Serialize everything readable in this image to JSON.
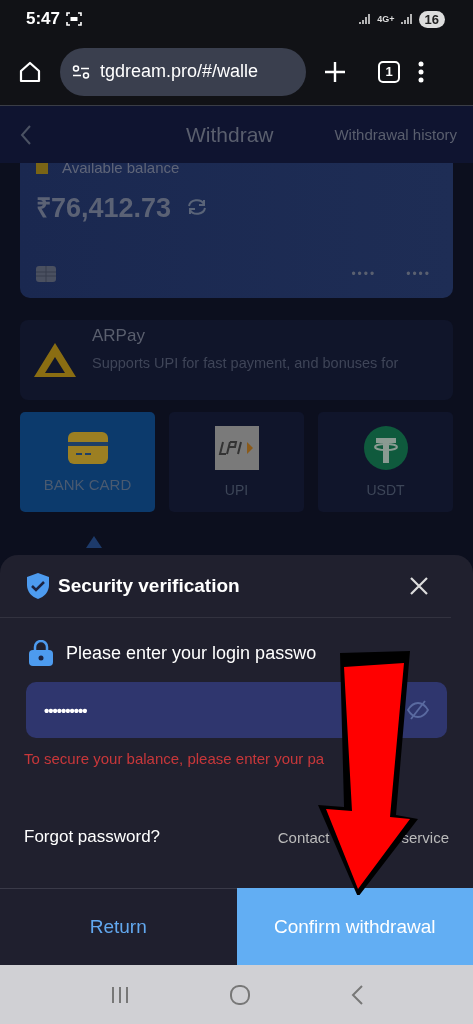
{
  "status_bar": {
    "time": "5:47",
    "network": "4G+",
    "battery": "16"
  },
  "browser": {
    "url": "tgdream.pro/#/walle",
    "tab_count": "1"
  },
  "header": {
    "title": "Withdraw",
    "link": "Withdrawal history"
  },
  "balance_card": {
    "label": "Available balance",
    "amount": "₹76,412.73",
    "masked_groups": [
      "••••",
      "••••"
    ]
  },
  "channel": {
    "name": "ARPay",
    "description": "Supports UPI for fast payment, and bonuses for"
  },
  "methods": [
    {
      "label": "BANK CARD",
      "kind": "card",
      "selected": true
    },
    {
      "label": "UPI",
      "kind": "upi",
      "selected": false
    },
    {
      "label": "USDT",
      "kind": "usdt",
      "selected": false
    }
  ],
  "dialog": {
    "title": "Security verification",
    "prompt": "Please enter your login passwo",
    "password": "••••••••••",
    "error": "To secure your balance, please enter your pa",
    "forgot": "Forgot password?",
    "contact": [
      "Contact",
      "service"
    ],
    "buttons": [
      {
        "label": "Return",
        "kind": "secondary"
      },
      {
        "label": "Confirm withdrawal",
        "kind": "primary"
      }
    ]
  }
}
